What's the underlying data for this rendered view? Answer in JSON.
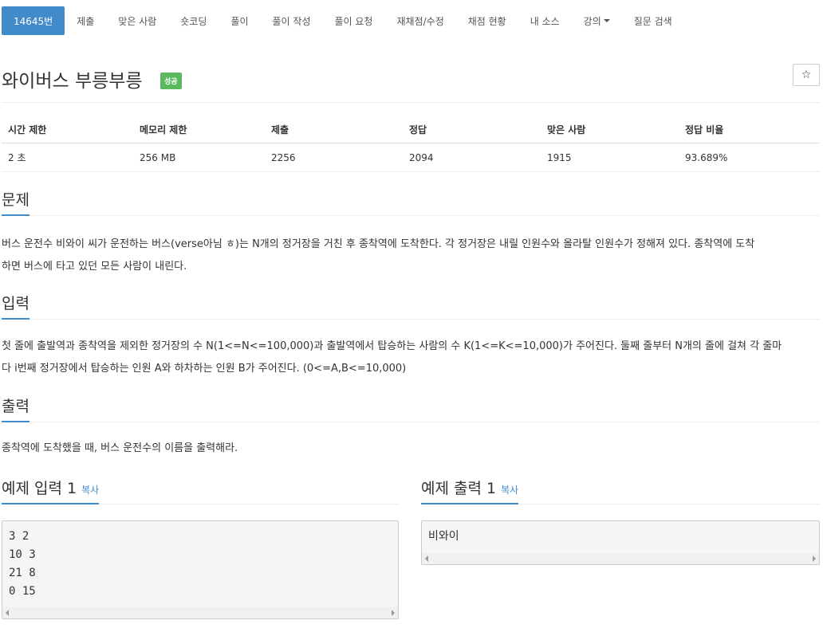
{
  "nav": {
    "tabs": [
      "14645번",
      "제출",
      "맞은 사람",
      "숏코딩",
      "풀이",
      "풀이 작성",
      "풀이 요청",
      "재채점/수정",
      "채점 현황",
      "내 소스",
      "강의"
    ],
    "last": "질문 검색"
  },
  "problem": {
    "title": "와이버스 부릉부릉",
    "badge": "성공",
    "star": "☆"
  },
  "info": {
    "headers": [
      "시간 제한",
      "메모리 제한",
      "제출",
      "정답",
      "맞은 사람",
      "정답 비율"
    ],
    "values": [
      "2 초",
      "256 MB",
      "2256",
      "2094",
      "1915",
      "93.689%"
    ]
  },
  "sections": {
    "problem_title": "문제",
    "problem_text_1": "버스 운전수 비와이 씨가 운전하는 버스(verse아님 ㅎ)는 N개의 정거장을 거친 후 종착역에 도착한다. 각 정거장은 내릴 인원수와 올라탈 인원수가 정해져 있다. 종착역에 도착",
    "problem_text_2": "하면 버스에 타고 있던 모든 사람이 내린다.",
    "input_title": "입력",
    "input_text_1": "첫 줄에 출발역과 종착역을 제외한 정거장의 수 N(1<=N<=100,000)과 출발역에서 탑승하는 사람의 수 K(1<=K<=10,000)가 주어진다. 둘째 줄부터 N개의 줄에 걸쳐 각 줄마",
    "input_text_2": "다 i번째 정거장에서 탑승하는 인원 A와 하차하는 인원 B가 주어진다. (0<=A,B<=10,000)",
    "output_title": "출력",
    "output_text": "종착역에 도착했을 때, 버스 운전수의 이름을 출력해라."
  },
  "samples": {
    "input_title": "예제 입력 1",
    "output_title": "예제 출력 1",
    "copy": "복사",
    "input_lines": [
      "3 2",
      "10 3",
      "21 8",
      "0 15"
    ],
    "output_lines": [
      "비와이"
    ]
  }
}
